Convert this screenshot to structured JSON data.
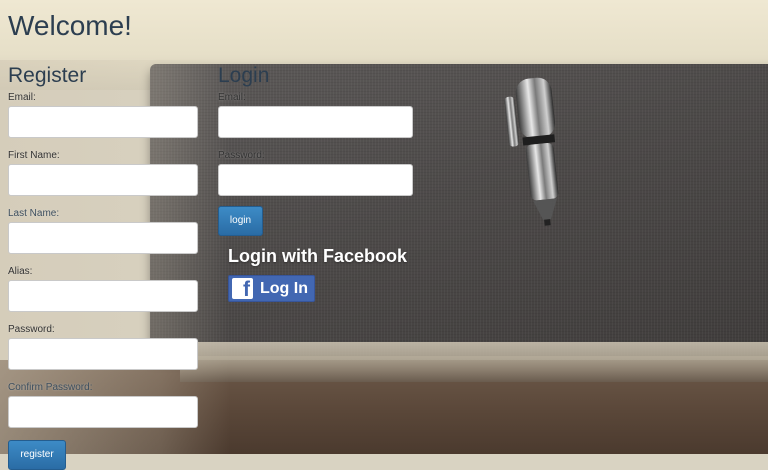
{
  "page": {
    "title": "Welcome!"
  },
  "register": {
    "heading": "Register",
    "fields": [
      {
        "label": "Email:",
        "value": ""
      },
      {
        "label": "First Name:",
        "value": ""
      },
      {
        "label": "Last Name:",
        "value": ""
      },
      {
        "label": "Alias:",
        "value": ""
      },
      {
        "label": "Password:",
        "value": ""
      },
      {
        "label": "Confirm Password:",
        "value": ""
      }
    ],
    "button_label": "register"
  },
  "login": {
    "heading": "Login",
    "fields": [
      {
        "label": "Email:",
        "value": ""
      },
      {
        "label": "Password:",
        "value": ""
      }
    ],
    "button_label": "login"
  },
  "facebook": {
    "heading": "Login with Facebook",
    "button_label": "Log In",
    "logo_glyph": "f",
    "brand_color": "#4267b2"
  },
  "colors": {
    "heading": "#2c3e50",
    "button": "#2a6ca5"
  }
}
